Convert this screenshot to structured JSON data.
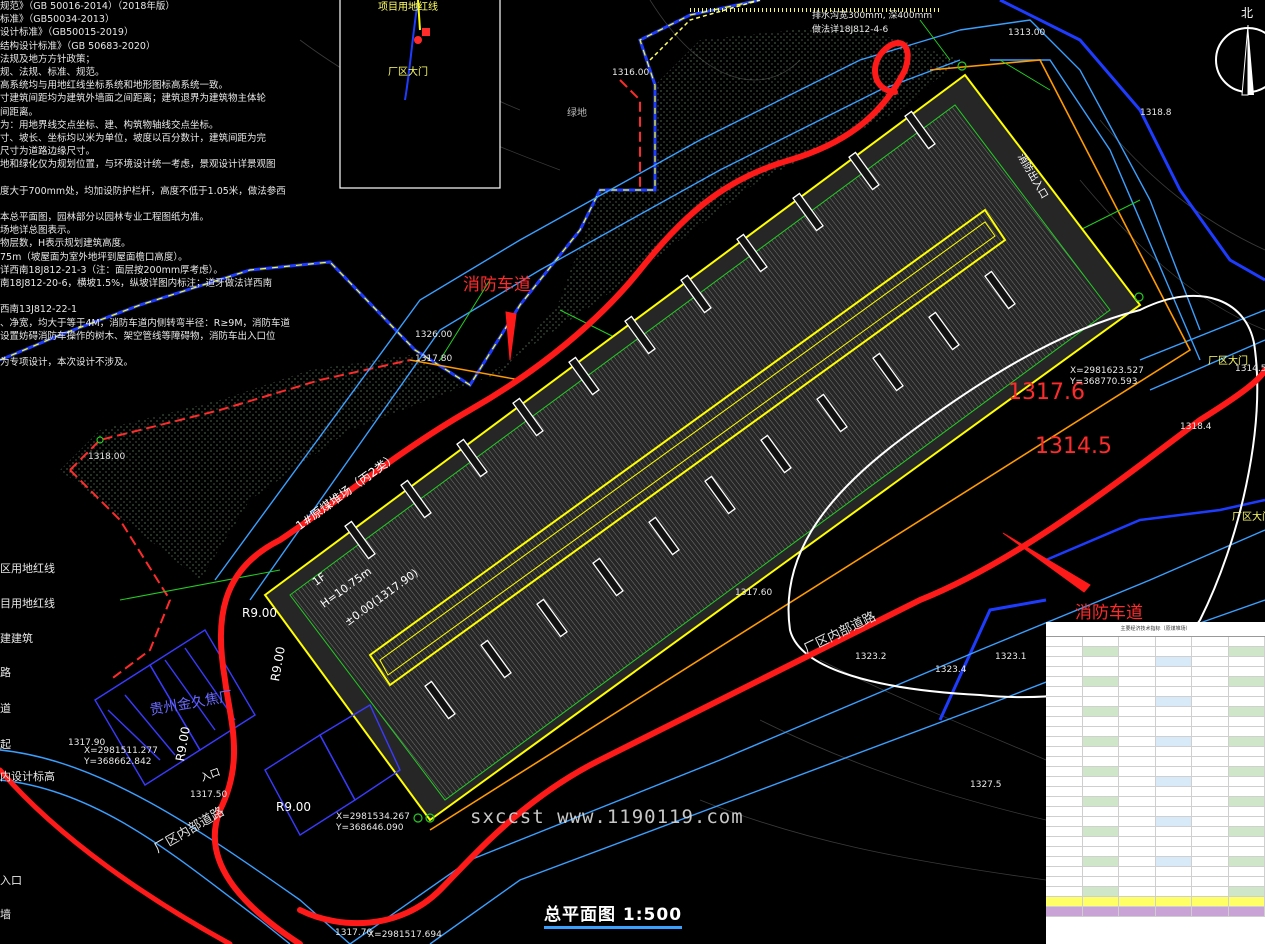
{
  "drawing": {
    "title": "总平面图 1:500",
    "watermark": "sxccst www.1190119.com",
    "north_label": "北"
  },
  "notes": [
    "规范》（GB 50016-2014）（2018年版）",
    "标准》（GB50034-2013）",
    "设计标准》（GB50015-2019）",
    "结构设计标准》（GB 50683-2020）",
    "法规及地方方针政策；",
    "规、法规、标准、规范。",
    "高系统均与用地红线坐标系统和地形图标高系统一致。",
    "寸建筑间距均为建筑外墙面之间距离；建筑退界为建筑物主体轮",
    "间距离。",
    "为：用地界线交点坐标、建、构筑物轴线交点坐标。",
    "寸、坡长、坐标均以米为单位，坡度以百分数计，建筑间距为完",
    "尺寸为道路边缘尺寸。",
    "地和绿化仅为规划位置，与环境设计统一考虑，景观设计详景观图",
    "",
    "度大于700mm处，均加设防护栏杆，高度不低于1.05米，做法参西",
    "",
    "本总平面图，园林部分以园林专业工程图纸为准。",
    "场地详总图表示。",
    "物层数，H表示规划建筑高度。",
    "75m（坡屋面为室外地坪到屋面檐口高度）。",
    "详西南18J812-21-3（注：面层按200mm厚考虑）。",
    "南18J812-20-6，横坡1.5%，纵坡详图内标注；道牙做法详西南",
    "",
    "西南13J812-22-1",
    "、净宽，均大于等于4M，消防车道内侧转弯半径：R≥9M，消防车道",
    "设置妨碍消防车操作的树木、架空管线等障碍物，消防车出入口位",
    "",
    "为专项设计，本次设计不涉及。"
  ],
  "legend_items": [
    "区用地红线",
    "目用地红线",
    "建建筑",
    "路",
    "道",
    "起",
    "内设计标高",
    "入口",
    "墙"
  ],
  "annotations": {
    "fire_lane_1": "消防车道",
    "fire_lane_2": "消防车道",
    "elev_1": "1317.6",
    "elev_2": "1314.5",
    "road_1": "厂区内部道路",
    "road_2": "厂区内部道路",
    "building_name": "1#原煤堆场（丙2类）",
    "building_floors": "1F",
    "building_height": "H=10.75m",
    "building_level": "±0.00(1317.90)",
    "r9_1": "R9.00",
    "r9_2": "R9.00",
    "r9_3": "R9.00",
    "r9_4": "R9.00",
    "coord_1_x": "X=2981623.527",
    "coord_1_y": "Y=368770.593",
    "coord_2_x": "X=2981534.267",
    "coord_2_y": "Y=368646.090",
    "coord_3_x": "X=2981517.694",
    "coord_4_x": "X=2981511.277",
    "coord_4_y": "Y=368662.842",
    "company": "贵州金久焦厂",
    "gate_1": "厂区大门",
    "gate_2": "厂区大门",
    "gate_inset": "厂区大门",
    "inset_label": "项目用地红线",
    "fire_in": "消防出入口",
    "fire_out": "入口",
    "elev_a": "1317.90",
    "elev_b": "1317.60",
    "elev_c": "1313.00",
    "elev_d": "1314.50",
    "elev_e": "1326.00",
    "elev_f": "1317.80",
    "elev_g": "1318.00",
    "elev_h": "1316.00",
    "elev_i": "1317.50",
    "elev_j": "1317.70",
    "elev_k": "1323.1",
    "elev_l": "1323.2",
    "elev_m": "1323.4",
    "elev_n": "1327.5",
    "elev_o": "1318.4",
    "elev_p": "1318.8",
    "gate_top_note1": "排水沟宽300mm, 深400mm",
    "gate_top_note2": "做法详18J812-4-6",
    "grass_label": "绿地"
  },
  "table": {
    "title": "主要经济技术指标（原煤堆场）",
    "rows": 28
  },
  "colors": {
    "fire_lane": "#ff1a1a",
    "white_ellipse": "#ffffff",
    "building_outline": "#ffff00",
    "road_line": "#3aa0ff",
    "redline_site": "#ff2b2b",
    "boundary": "#1e3cff",
    "green_line": "#22cc22",
    "orange": "#ff9a00"
  }
}
